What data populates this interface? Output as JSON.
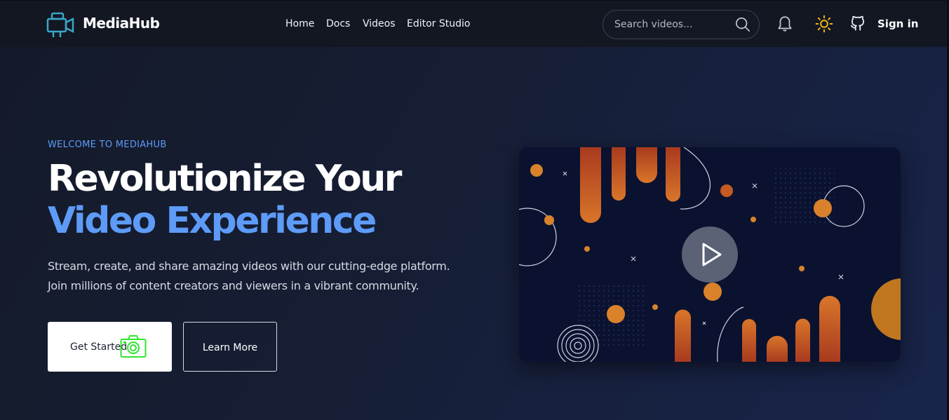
{
  "brand": {
    "name": "MediaHub",
    "logo_icon": "video-camera-icon"
  },
  "nav": {
    "links": [
      "Home",
      "Docs",
      "Videos",
      "Editor Studio"
    ],
    "search_placeholder": "Search videos...",
    "sign_in": "Sign in",
    "icons": [
      "search-icon",
      "bell-icon",
      "sun-icon",
      "github-icon"
    ]
  },
  "hero": {
    "eyebrow": "WELCOME TO MEDIAHUB",
    "title_line1": "Revolutionize Your",
    "title_line2": "Video Experience",
    "description": "Stream, create, and share amazing videos with our cutting-edge platform. Join millions of content creators and viewers in a vibrant community.",
    "primary_button": "Get Started",
    "primary_button_icon": "camera-icon",
    "secondary_button": "Learn More",
    "media_icon": "play-icon"
  },
  "colors": {
    "accent": "#5d9bf7",
    "nav_bg": "#121722",
    "camera_icon": "#2ee62e",
    "sun_icon": "#f5b81c",
    "art_orange": "#d9762a"
  }
}
